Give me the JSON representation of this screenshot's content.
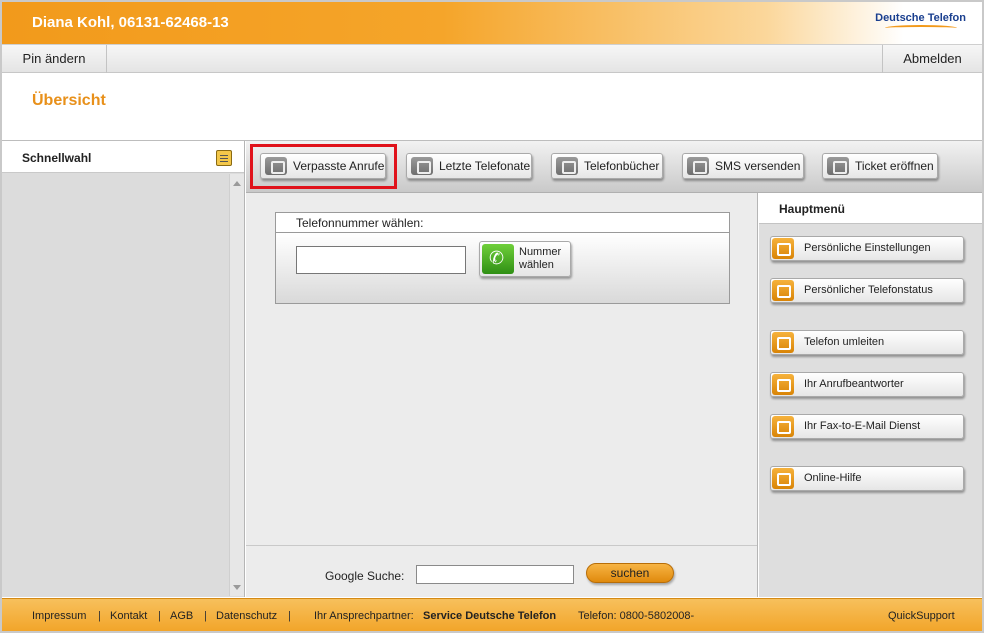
{
  "header": {
    "title": "Diana Kohl, 06131-62468-13",
    "brand": "Deutsche Telefon"
  },
  "toolbar": {
    "pin_label": "Pin ändern",
    "logout_label": "Abmelden"
  },
  "page": {
    "title": "Übersicht"
  },
  "sidebar": {
    "title": "Schnellwahl"
  },
  "actions": [
    {
      "label": "Verpasste Anrufe",
      "icon": "missed-call-icon"
    },
    {
      "label": "Letzte Telefonate",
      "icon": "recent-calls-icon"
    },
    {
      "label": "Telefonbücher",
      "icon": "phonebook-icon"
    },
    {
      "label": "SMS versenden",
      "icon": "sms-icon"
    },
    {
      "label": "Ticket eröffnen",
      "icon": "ticket-icon"
    }
  ],
  "dial": {
    "heading": "Telefonnummer wählen:",
    "input_value": "",
    "button_line1": "Nummer",
    "button_line2": "wählen"
  },
  "google": {
    "label": "Google Suche:",
    "input_value": "",
    "button_label": "suchen"
  },
  "menu": {
    "title": "Hauptmenü",
    "items": [
      {
        "label": "Persönliche Einstellungen",
        "icon": "settings-icon"
      },
      {
        "label": "Persönlicher Telefonstatus",
        "icon": "phone-status-icon"
      },
      {
        "label": "Telefon umleiten",
        "icon": "redirect-icon"
      },
      {
        "label": "Ihr Anrufbeantworter",
        "icon": "voicemail-icon"
      },
      {
        "label": "Ihr Fax-to-E-Mail Dienst",
        "icon": "fax-mail-icon"
      },
      {
        "label": "Online-Hilfe",
        "icon": "help-book-icon"
      }
    ]
  },
  "footer": {
    "links": [
      "Impressum",
      "Kontakt",
      "AGB",
      "Datenschutz"
    ],
    "separator": "|",
    "contact_label": "Ihr Ansprechpartner:",
    "contact_name": "Service Deutsche Telefon",
    "phone": "Telefon: 0800-5802008-",
    "quicksupport": "QuickSupport"
  },
  "colors": {
    "accent_orange": "#f29a1b",
    "title_orange": "#e8901a",
    "brand_blue": "#1a3f8f",
    "highlight_red": "#e0121b"
  }
}
